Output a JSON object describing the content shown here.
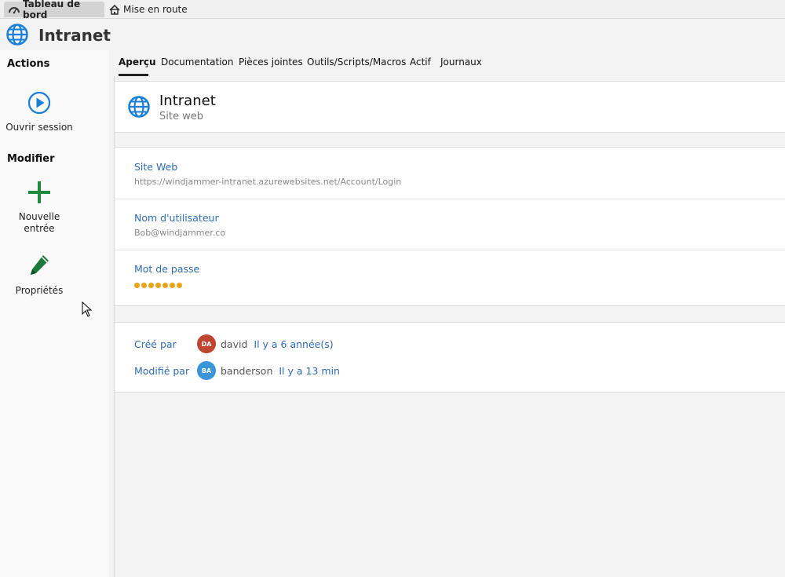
{
  "top_tabs": [
    {
      "label": "Tableau de bord",
      "icon": "dashboard-icon"
    },
    {
      "label": "Mise en route",
      "icon": "home-icon"
    }
  ],
  "app": {
    "title": "Intranet",
    "icon": "globe-icon"
  },
  "sidebar": {
    "actions_heading": "Actions",
    "open_session_label": "Ouvrir session",
    "modify_heading": "Modifier",
    "new_entry_label": "Nouvelle entrée",
    "properties_label": "Propriétés"
  },
  "content_tabs": [
    "Aperçu",
    "Documentation",
    "Pièces jointes",
    "Outils/Scripts/Macros",
    "Actif",
    "Journaux"
  ],
  "entry": {
    "name": "Intranet",
    "type": "Site web",
    "fields": [
      {
        "label": "Site Web",
        "value": "https://windjammer-intranet.azurewebsites.net/Account/Login"
      },
      {
        "label": "Nom d'utilisateur",
        "value": "Bob@windjammer.co"
      },
      {
        "label": "Mot de passe",
        "masked_length": 7
      }
    ]
  },
  "meta": {
    "created": {
      "label": "Créé par",
      "initials": "DA",
      "user": "david",
      "time": "Il y a 6 année(s)",
      "color": "#c0452f"
    },
    "modified": {
      "label": "Modifié par",
      "initials": "BA",
      "user": "banderson",
      "time": "Il y a 13 min",
      "color": "#3a95d9"
    }
  },
  "colors": {
    "accent": "#2e6db4",
    "password_dots": "#e8a317",
    "add_icon": "#1e8a3c",
    "pencil_icon": "#1e7a3a"
  }
}
